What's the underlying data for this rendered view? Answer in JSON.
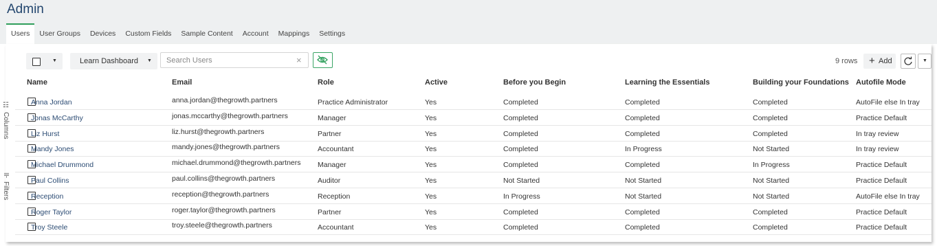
{
  "page": {
    "title": "Admin"
  },
  "tabs": [
    "Users",
    "User Groups",
    "Devices",
    "Custom Fields",
    "Sample Content",
    "Account",
    "Mappings",
    "Settings"
  ],
  "active_tab": "Users",
  "sidebar": {
    "columns_label": "Columns",
    "filters_label": "Filters"
  },
  "toolbar": {
    "dashboard_select": "Learn Dashboard",
    "search_placeholder": "Search Users",
    "rows_count": "9 rows",
    "add_label": "Add"
  },
  "table": {
    "columns": [
      "Name",
      "Email",
      "Role",
      "Active",
      "Before you Begin",
      "Learning the Essentials",
      "Building your Foundations",
      "Autofile Mode"
    ],
    "rows": [
      [
        "Anna Jordan",
        "anna.jordan@thegrowth.partners",
        "Practice Administrator",
        "Yes",
        "Completed",
        "Completed",
        "Completed",
        "AutoFile else In tray"
      ],
      [
        "Jonas McCarthy",
        "jonas.mccarthy@thegrowth.partners",
        "Manager",
        "Yes",
        "Completed",
        "Completed",
        "Completed",
        "Practice Default"
      ],
      [
        "Liz Hurst",
        "liz.hurst@thegrowth.partners",
        "Partner",
        "Yes",
        "Completed",
        "Completed",
        "Completed",
        "In tray review"
      ],
      [
        "Mandy Jones",
        "mandy.jones@thegrowth.partners",
        "Accountant",
        "Yes",
        "Completed",
        "In Progress",
        "Not Started",
        "In tray review"
      ],
      [
        "Michael Drummond",
        "michael.drummond@thegrowth.partners",
        "Manager",
        "Yes",
        "Completed",
        "Completed",
        "In Progress",
        "Practice Default"
      ],
      [
        "Paul Collins",
        "paul.collins@thegrowth.partners",
        "Auditor",
        "Yes",
        "Not Started",
        "Not Started",
        "Not Started",
        "Practice Default"
      ],
      [
        "Reception",
        "reception@thegrowth.partners",
        "Reception",
        "Yes",
        "In Progress",
        "Not Started",
        "Not Started",
        "AutoFile else In tray"
      ],
      [
        "Roger Taylor",
        "roger.taylor@thegrowth.partners",
        "Partner",
        "Yes",
        "Completed",
        "Completed",
        "Completed",
        "Practice Default"
      ],
      [
        "Troy Steele",
        "troy.steele@thegrowth.partners",
        "Accountant",
        "Yes",
        "Completed",
        "Completed",
        "Completed",
        "Practice Default"
      ]
    ]
  },
  "colors": {
    "accent": "#2f9e5a",
    "title": "#23466e",
    "name_link": "#2b4b73",
    "header_bg": "#eef0f1"
  },
  "icons": {
    "toggle_visibility": "eye-off-icon",
    "refresh": "refresh-icon",
    "add": "plus-icon"
  }
}
